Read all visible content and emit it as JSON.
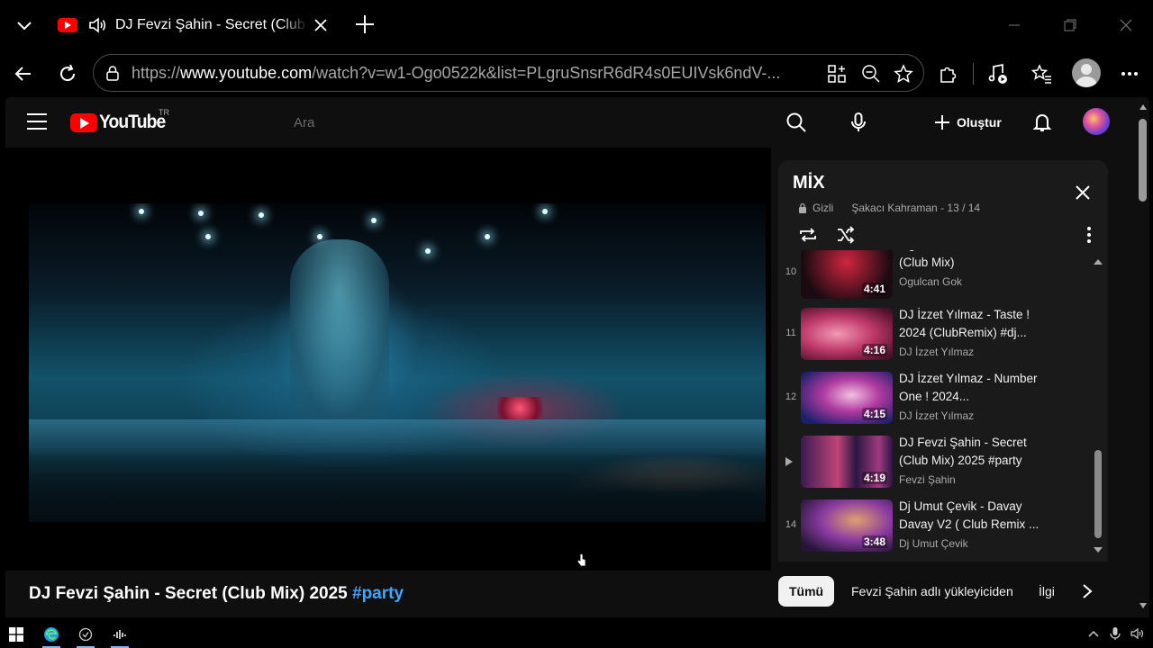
{
  "browser": {
    "tab": {
      "title": "DJ Fevzi Şahin - Secret (Club Mix)",
      "favicon": "youtube-icon",
      "audio_icon": "speaker-icon"
    },
    "url": {
      "prefix": "https://",
      "host": "www.youtube.com",
      "path": "/watch?v=w1-Ogo0522k&list=PLgruSnsrR6dR4s0EUIVsk6ndV-..."
    }
  },
  "youtube": {
    "logo_text": "YouTube",
    "region": "TR",
    "search_placeholder": "Ara",
    "create_label": "Oluştur"
  },
  "video": {
    "title": "DJ Fevzi Şahin - Secret (Club Mix) 2025",
    "hashtag": "#party"
  },
  "playlist": {
    "title": "MİX",
    "privacy": "Gizli",
    "owner_progress": "Şakacı Kahraman - 13 / 14",
    "items": [
      {
        "index": "10",
        "title": "Ogulcan Gok - ClubStar (Club Mix)",
        "channel": "Ogulcan Gok",
        "duration": "4:41",
        "thumb_colors": [
          "#1a0a12",
          "#c0223a"
        ]
      },
      {
        "index": "11",
        "title": "DJ İzzet Yılmaz - Taste ! 2024 (ClubRemix) #dj...",
        "channel": "DJ İzzet Yılmaz",
        "duration": "4:16",
        "thumb_colors": [
          "#5a1330",
          "#e0568a"
        ]
      },
      {
        "index": "12",
        "title": "DJ İzzet Yılmaz - Number One ! 2024...",
        "channel": "DJ İzzet Yılmaz",
        "duration": "4:15",
        "thumb_colors": [
          "#1c1f6a",
          "#d24aa8"
        ]
      },
      {
        "index": "",
        "title": "DJ Fevzi Şahin - Secret (Club Mix) 2025 #party",
        "channel": "Fevzi Şahin",
        "duration": "4:19",
        "thumb_colors": [
          "#2a1640",
          "#c0447a"
        ],
        "current": true
      },
      {
        "index": "14",
        "title": "Dj Umut Çevik - Davay Davay V2 ( Club Remix ...",
        "channel": "Dj Umut Çevik",
        "duration": "3:48",
        "thumb_colors": [
          "#251538",
          "#8a3aa0"
        ]
      }
    ]
  },
  "chips": [
    "Tümü",
    "Fevzi Şahin adlı yükleyiciden",
    "İlgi"
  ],
  "colors": {
    "accent_link": "#3ea6ff",
    "youtube_red": "#ff0000",
    "background": "#0f0f0f"
  }
}
